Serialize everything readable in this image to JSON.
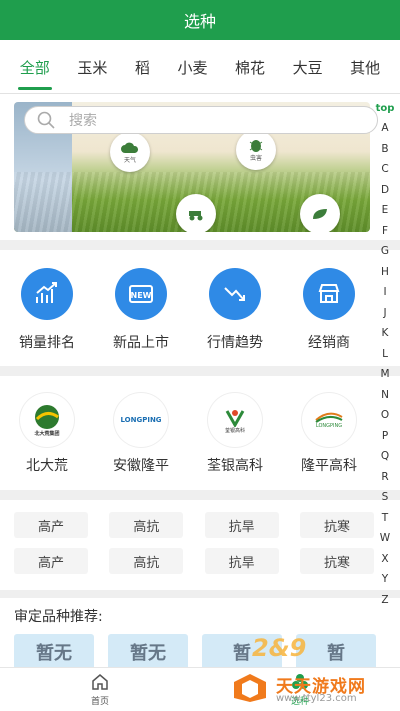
{
  "header": {
    "title": "选种"
  },
  "tabs": [
    {
      "label": "全部",
      "active": true
    },
    {
      "label": "玉米"
    },
    {
      "label": "稻"
    },
    {
      "label": "小麦"
    },
    {
      "label": "棉花"
    },
    {
      "label": "大豆"
    },
    {
      "label": "其他"
    }
  ],
  "search": {
    "placeholder": "搜索"
  },
  "banner": {
    "bubble_weather": "天气",
    "bubble_pest": "虫害"
  },
  "quick": [
    {
      "label": "销量排名",
      "icon": "sales-chart-icon"
    },
    {
      "label": "新品上市",
      "icon": "new-badge-icon"
    },
    {
      "label": "行情趋势",
      "icon": "trend-down-icon"
    },
    {
      "label": "经销商",
      "icon": "store-icon"
    }
  ],
  "brands": [
    {
      "label": "北大荒",
      "logo_text": "北大荒集团"
    },
    {
      "label": "安徽隆平",
      "logo_text": "LONGPING"
    },
    {
      "label": "荃银高科",
      "logo_text": "荃银高科"
    },
    {
      "label": "隆平高科",
      "logo_text": "LONGPING"
    }
  ],
  "tags": [
    [
      "高产",
      "高抗",
      "抗旱",
      "抗寒"
    ],
    [
      "高产",
      "高抗",
      "抗旱",
      "抗寒"
    ]
  ],
  "recommend": {
    "title": "审定品种推荐:",
    "cards": [
      "暂无",
      "暂无",
      "暂",
      "暂"
    ]
  },
  "alpha_index": {
    "top": "top",
    "letters": [
      "A",
      "B",
      "C",
      "D",
      "E",
      "F",
      "G",
      "H",
      "I",
      "J",
      "K",
      "L",
      "M",
      "N",
      "O",
      "P",
      "Q",
      "R",
      "S",
      "T",
      "W",
      "X",
      "Y",
      "Z"
    ]
  },
  "bottom_nav": [
    {
      "label": "首页",
      "icon": "home-icon"
    },
    {
      "label": "选种",
      "icon": "seed-icon",
      "active": true
    }
  ],
  "watermark": {
    "text": "天天游戏网",
    "url": "www.ttyl23.com",
    "overlay": "2&9"
  },
  "colors": {
    "brand_green": "#1f9e4d",
    "icon_blue": "#2f8ae6"
  }
}
